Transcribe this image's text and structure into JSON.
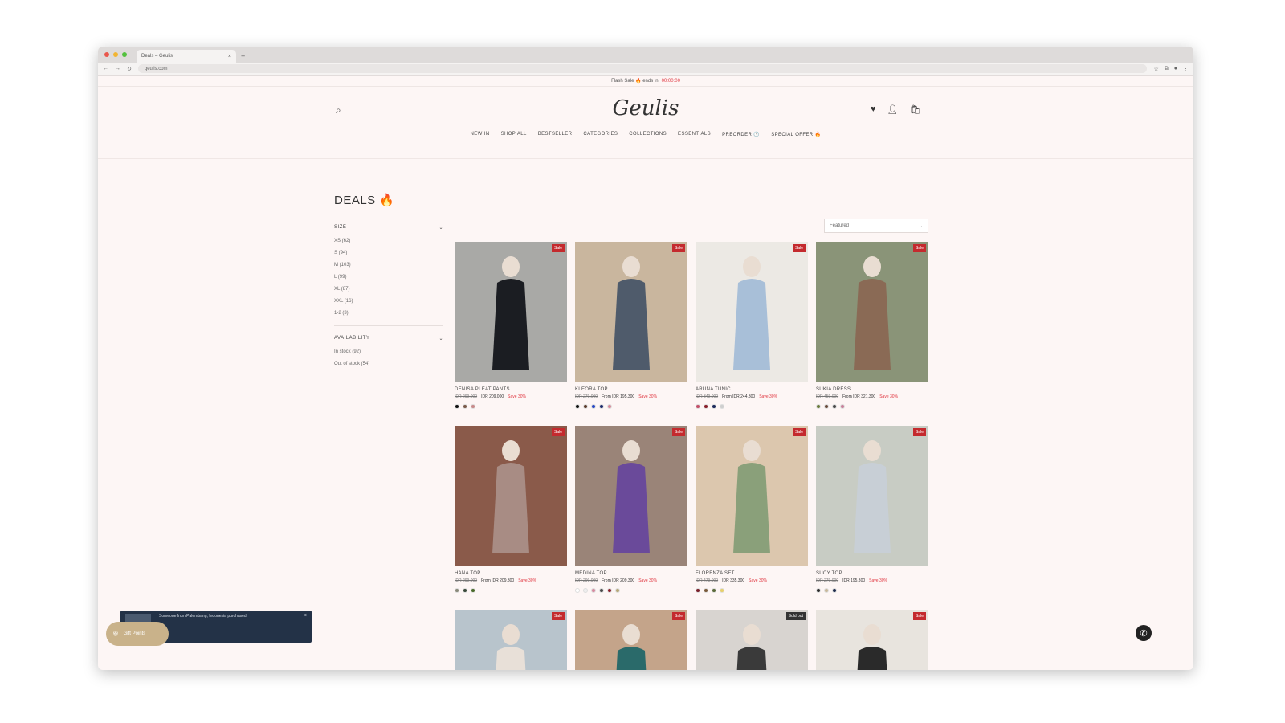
{
  "browser": {
    "tab_title": "Deals – Geulis",
    "url": "geulis.com",
    "new_tab": "+",
    "tab_close": "×"
  },
  "promo": {
    "text": "Flash Sale 🔥 ends in",
    "highlight": "00:00:00"
  },
  "header": {
    "logo": "Geulis",
    "nav": [
      "NEW IN",
      "SHOP ALL",
      "BESTSELLER",
      "CATEGORIES",
      "COLLECTIONS",
      "ESSENTIALS",
      "PREORDER 🕐",
      "SPECIAL OFFER 🔥"
    ]
  },
  "page": {
    "title": "DEALS 🔥"
  },
  "filters": {
    "size_label": "SIZE",
    "sizes": [
      "XS (62)",
      "S (94)",
      "M (103)",
      "L (99)",
      "XL (87)",
      "XXL (16)",
      "1-2 (3)"
    ],
    "availability_label": "AVAILABILITY",
    "availability": [
      "In stock (92)",
      "Out of stock (54)"
    ]
  },
  "sort": {
    "label": "Featured"
  },
  "products": [
    {
      "name": "DENISA PLEAT PANTS",
      "old": "IDR 299,000",
      "now": "IDR 209,000",
      "save": "Save 30%",
      "badge": "Sale",
      "bg": "#a9a9a6",
      "fig": "#1b1d22",
      "swatches": [
        "#111111",
        "#7a5a4a",
        "#c98a8a"
      ]
    },
    {
      "name": "KLEORA TOP",
      "old": "IDR 279,000",
      "now": "From IDR 195,300",
      "save": "Save 30%",
      "badge": "Sale",
      "bg": "#c9b69e",
      "fig": "#4f5b6b",
      "swatches": [
        "#111111",
        "#5b3a2a",
        "#2747c4",
        "#1d2a6b",
        "#d98a9a"
      ]
    },
    {
      "name": "ARUNA TUNIC",
      "old": "IDR 349,000",
      "now": "From IDR 244,300",
      "save": "Save 30%",
      "badge": "Sale",
      "bg": "#ece9e4",
      "fig": "#a8bfd8",
      "swatches": [
        "#c4506a",
        "#8a1f2a",
        "#1d2a5b",
        "#cfcfcf"
      ]
    },
    {
      "name": "SUKIA DRESS",
      "old": "IDR 459,000",
      "now": "From IDR 321,300",
      "save": "Save 30%",
      "badge": "Sale",
      "bg": "#8a9478",
      "fig": "#8a6a55",
      "swatches": [
        "#6a7a3a",
        "#6a4a3a",
        "#4a4a4a",
        "#c9809a"
      ]
    },
    {
      "name": "HANA TOP",
      "old": "IDR 299,000",
      "now": "From IDR 209,300",
      "save": "Save 30%",
      "badge": "Sale",
      "bg": "#8a5a4a",
      "fig": "#a88c84",
      "swatches": [
        "#8a8a7a",
        "#3a4a3a",
        "#4a6a2a"
      ]
    },
    {
      "name": "MEDINA TOP",
      "old": "IDR 299,000",
      "now": "From IDR 209,300",
      "save": "Save 30%",
      "badge": "Sale",
      "bg": "#9a8478",
      "fig": "#6a4a9a",
      "swatches": [
        "#ffffff",
        "#eeeeee",
        "#d88aa0",
        "#4a4a4a",
        "#8a1f2a",
        "#b8a878"
      ]
    },
    {
      "name": "FLORENZA SET",
      "old": "IDR 479,000",
      "now": "IDR 335,300",
      "save": "Save 30%",
      "badge": "Sale",
      "bg": "#dcc7ae",
      "fig": "#8aa07a",
      "swatches": [
        "#7a1f2a",
        "#7a5a3a",
        "#5a6a3a",
        "#e8d06a"
      ]
    },
    {
      "name": "SUCY TOP",
      "old": "IDR 279,000",
      "now": "IDR 195,300",
      "save": "Save 30%",
      "badge": "Sale",
      "bg": "#c8ccc4",
      "fig": "#c8cfd6",
      "swatches": [
        "#2a2a2a",
        "#c8b89a",
        "#1d2a4b"
      ]
    },
    {
      "badge": "Sale",
      "bg": "#b8c4cc",
      "fig": "#e8e0d8"
    },
    {
      "badge": "Sale",
      "bg": "#c4a48a",
      "fig": "#2a6a6a"
    },
    {
      "badge": "Sold out",
      "badge_dark": true,
      "bg": "#d8d4d0",
      "fig": "#3a3a3a"
    },
    {
      "badge": "Sale",
      "bg": "#e8e4de",
      "fig": "#2a2a2a"
    }
  ],
  "popup": {
    "text": "Someone from Palembang, Indonesia purchased",
    "close": "×"
  },
  "gift": {
    "label": "Gift Points"
  }
}
